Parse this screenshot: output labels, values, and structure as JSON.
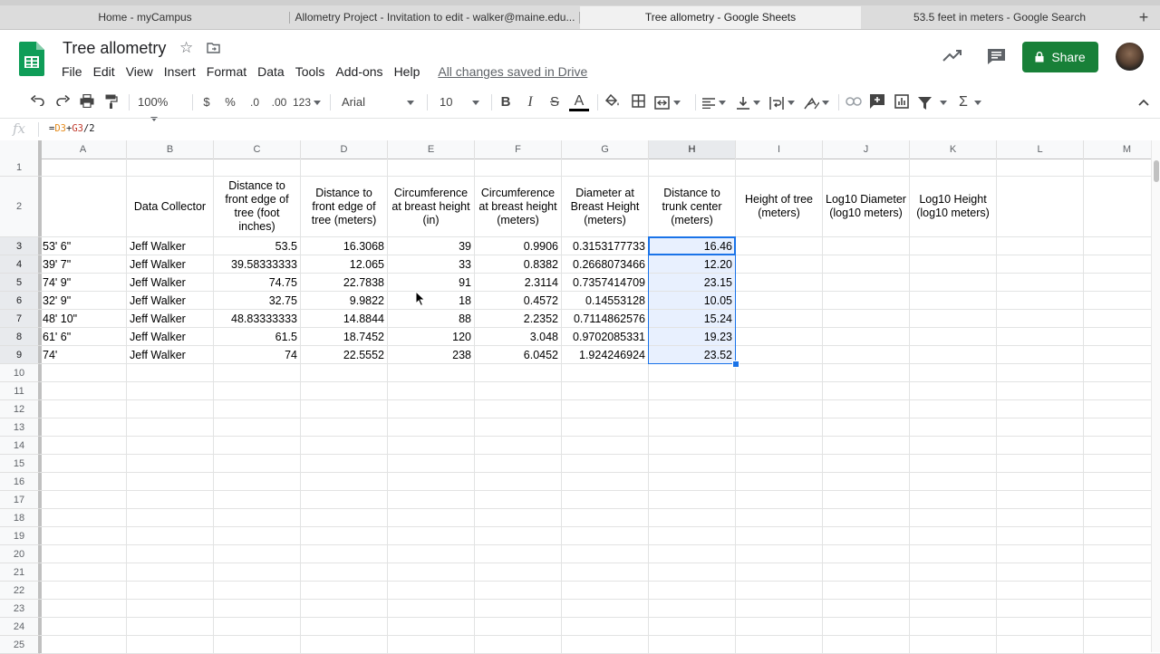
{
  "browser_tabs": [
    {
      "label": "Home - myCampus",
      "active": false
    },
    {
      "label": "Allometry Project - Invitation to edit - walker@maine.edu...",
      "active": false
    },
    {
      "label": "Tree allometry - Google Sheets",
      "active": true
    },
    {
      "label": "53.5 feet in meters - Google Search",
      "active": false
    }
  ],
  "new_tab_label": "+",
  "doc": {
    "title": "Tree allometry",
    "menu": [
      "File",
      "Edit",
      "View",
      "Insert",
      "Format",
      "Data",
      "Tools",
      "Add-ons",
      "Help"
    ],
    "save_status": "All changes saved in Drive",
    "share_label": "Share"
  },
  "toolbar": {
    "zoom": "100%",
    "currency": "$",
    "percent": "%",
    "decrease_decimals": ".0",
    "increase_decimals": ".00",
    "more_formats": "123",
    "font": "Arial",
    "font_size": "10",
    "bold": "B",
    "italic": "I",
    "strike": "S",
    "text_color": "A",
    "sum": "Σ"
  },
  "formula_bar": {
    "fx": "fx",
    "formula_parts": [
      "=",
      "D3",
      "+",
      "G3",
      "/2"
    ]
  },
  "columns": [
    "A",
    "B",
    "C",
    "D",
    "E",
    "F",
    "G",
    "H",
    "I",
    "J",
    "K",
    "L",
    "M"
  ],
  "selected_column": "H",
  "row_numbers": [
    "1",
    "2",
    "3",
    "4",
    "5",
    "6",
    "7",
    "8",
    "9",
    "10",
    "11",
    "12",
    "13",
    "14",
    "15",
    "16",
    "17",
    "18",
    "19",
    "20",
    "21",
    "22",
    "23",
    "24",
    "25"
  ],
  "header_row": [
    "",
    "Data Collector",
    "Distance to front edge of tree (foot inches)",
    "Distance to front edge of tree (meters)",
    "Circumference at breast height (in)",
    "Circumference at breast height (meters)",
    "Diameter at Breast Height (meters)",
    "Distance to trunk center (meters)",
    "Height of tree (meters)",
    "Log10 Diameter (log10 meters)",
    "Log10 Height (log10 meters)"
  ],
  "data_rows": [
    [
      "53' 6\"",
      "Jeff Walker",
      "53.5",
      "16.3068",
      "39",
      "0.9906",
      "0.3153177733",
      "16.46"
    ],
    [
      "39' 7\"",
      "Jeff Walker",
      "39.58333333",
      "12.065",
      "33",
      "0.8382",
      "0.2668073466",
      "12.20"
    ],
    [
      "74' 9\"",
      "Jeff Walker",
      "74.75",
      "22.7838",
      "91",
      "2.3114",
      "0.7357414709",
      "23.15"
    ],
    [
      "32' 9\"",
      "Jeff Walker",
      "32.75",
      "9.9822",
      "18",
      "0.4572",
      "0.14553128",
      "10.05"
    ],
    [
      "48' 10\"",
      "Jeff Walker",
      "48.83333333",
      "14.8844",
      "88",
      "2.2352",
      "0.7114862576",
      "15.24"
    ],
    [
      "61' 6\"",
      "Jeff Walker",
      "61.5",
      "18.7452",
      "120",
      "3.048",
      "0.9702085331",
      "19.23"
    ],
    [
      "74'",
      "Jeff Walker",
      "74",
      "22.5552",
      "238",
      "6.0452",
      "1.924246924",
      "23.52"
    ]
  ],
  "colors": {
    "share_green": "#188038",
    "selection_blue": "#1a73e8",
    "selection_fill": "#e8f0fe",
    "sheets_green": "#0f9d58"
  }
}
